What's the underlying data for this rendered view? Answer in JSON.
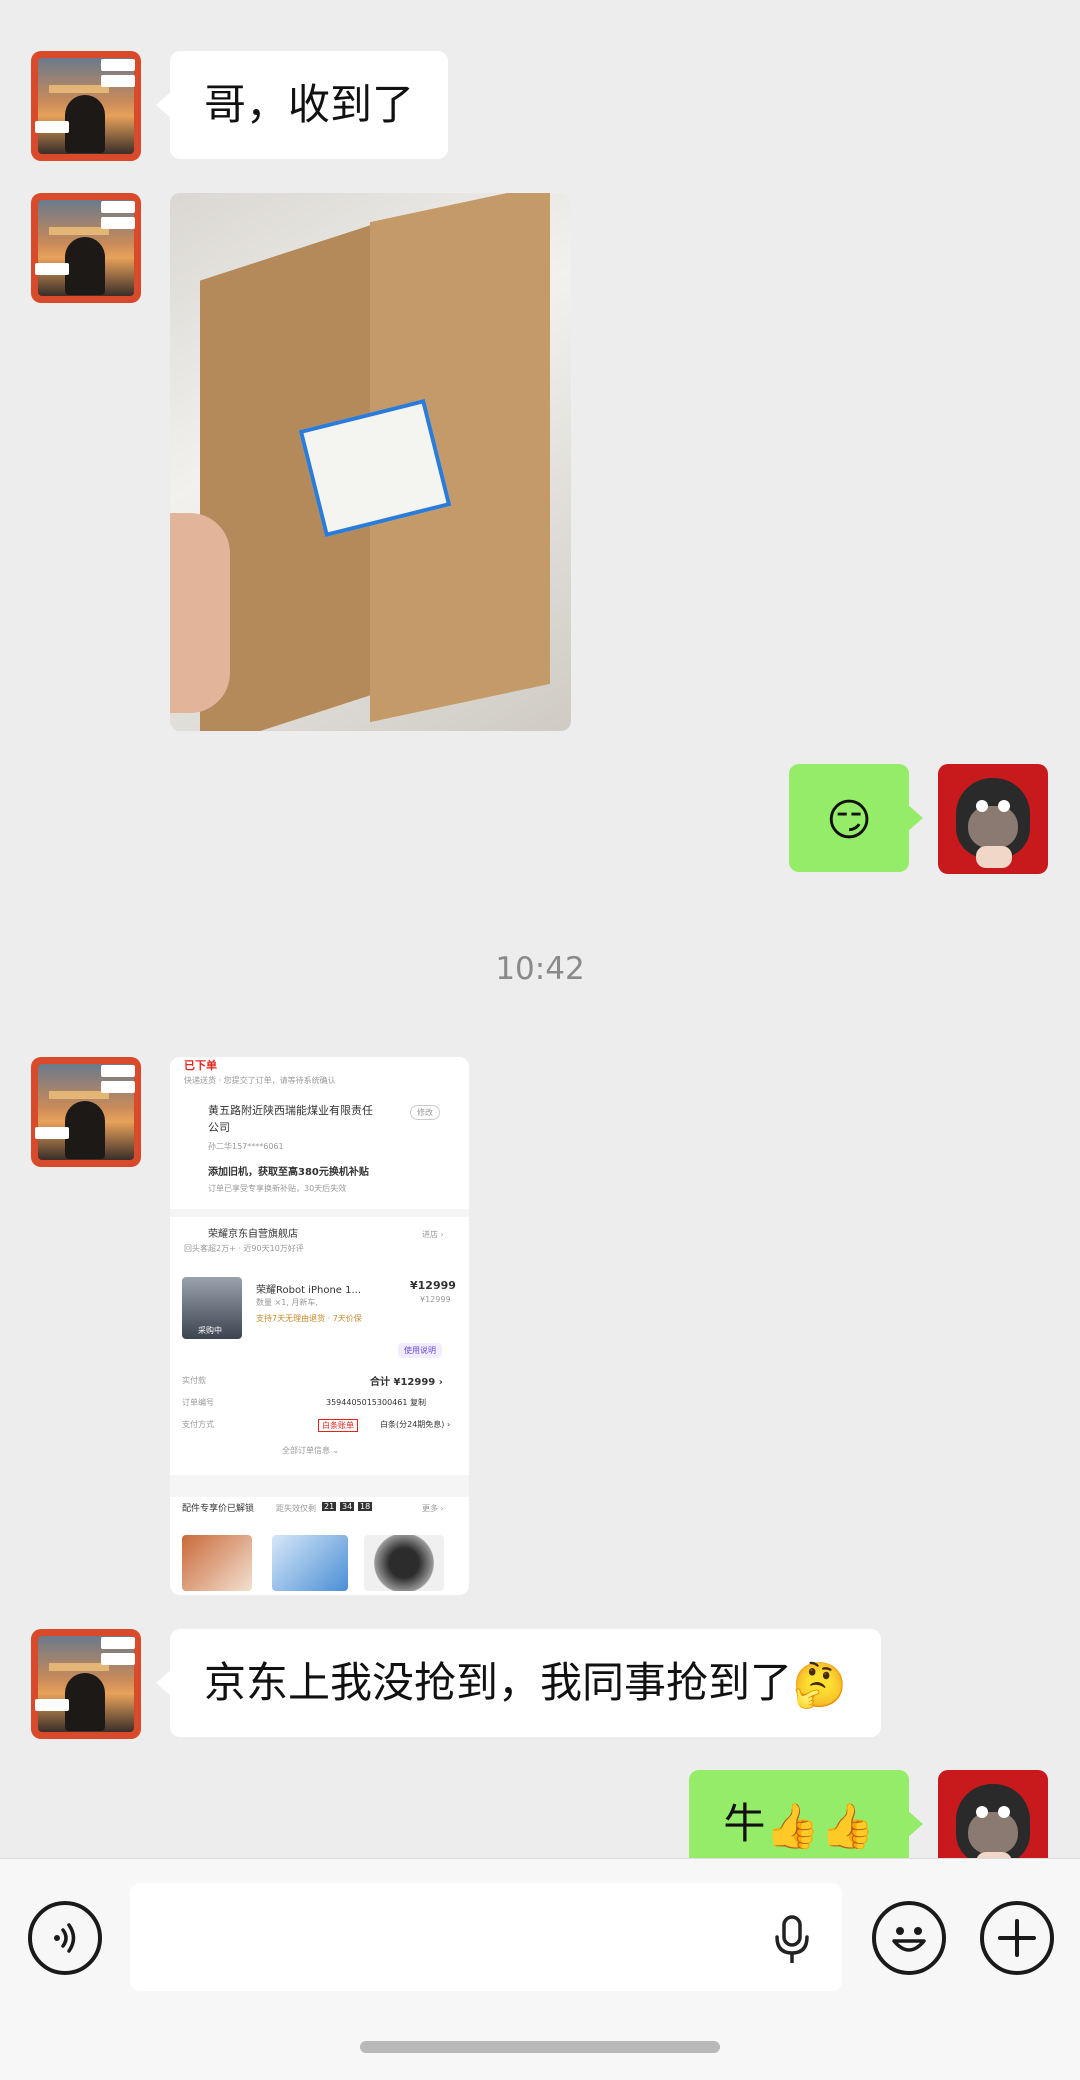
{
  "messages": {
    "m1_text": "哥，收到了",
    "m2_image_desc": "",
    "m3_emoji": "😏",
    "timestamp": "10:42",
    "m5_text": "京东上我没抢到，我同事抢到了",
    "m5_emoji": "🤔",
    "m6_text": "牛",
    "m6_emoji": "👍👍"
  },
  "order_screenshot": {
    "status": "已下单",
    "status_sub": "快递送货 · 您提交了订单，请等待系统确认",
    "address": "黄五路附近陕西瑞能煤业有限责任",
    "address2": "公司",
    "modify": "修改",
    "phone": "孙二华157****6061",
    "tradein": "添加旧机，获取至高380元换机补贴",
    "tradein_sub": "订单已享受专享换新补贴，30天后失效",
    "store": "荣耀京东自营旗舰店",
    "store_sub": "回头客超2万+ · 近90天10万好评",
    "store_link": "进店 ›",
    "product": "荣耀Robot iPhone 1...",
    "price": "¥12999",
    "price2": "¥12999",
    "product_sub": "数量 ×1, 月新车,",
    "product_tag": "支持7天无理由退货 · 7天价保",
    "thumb_label": "采购中",
    "ai_help": "使用说明",
    "paid_label": "实付款",
    "paid_value": "合计 ¥12999 ›",
    "order_label": "订单编号",
    "order_value": "3594405015300461  复制",
    "pay_label": "支付方式",
    "pay_badge": "白条账单",
    "pay_value": "白条(分24期免息) ›",
    "all_info": "全部订单信息 ⌄",
    "accessory": "配件专享价已解锁",
    "accessory_timer": "距失效仅剩",
    "timer": [
      "21",
      "34",
      "18"
    ],
    "accessory_more": "更多 ›"
  },
  "input_bar": {
    "voice_icon": "voice-icon",
    "mic_icon": "microphone-icon",
    "emoji_icon": "smiley-icon",
    "plus_icon": "plus-icon",
    "placeholder": ""
  },
  "colors": {
    "background": "#ededed",
    "bubble_left": "#ffffff",
    "bubble_right": "#95ec69"
  }
}
